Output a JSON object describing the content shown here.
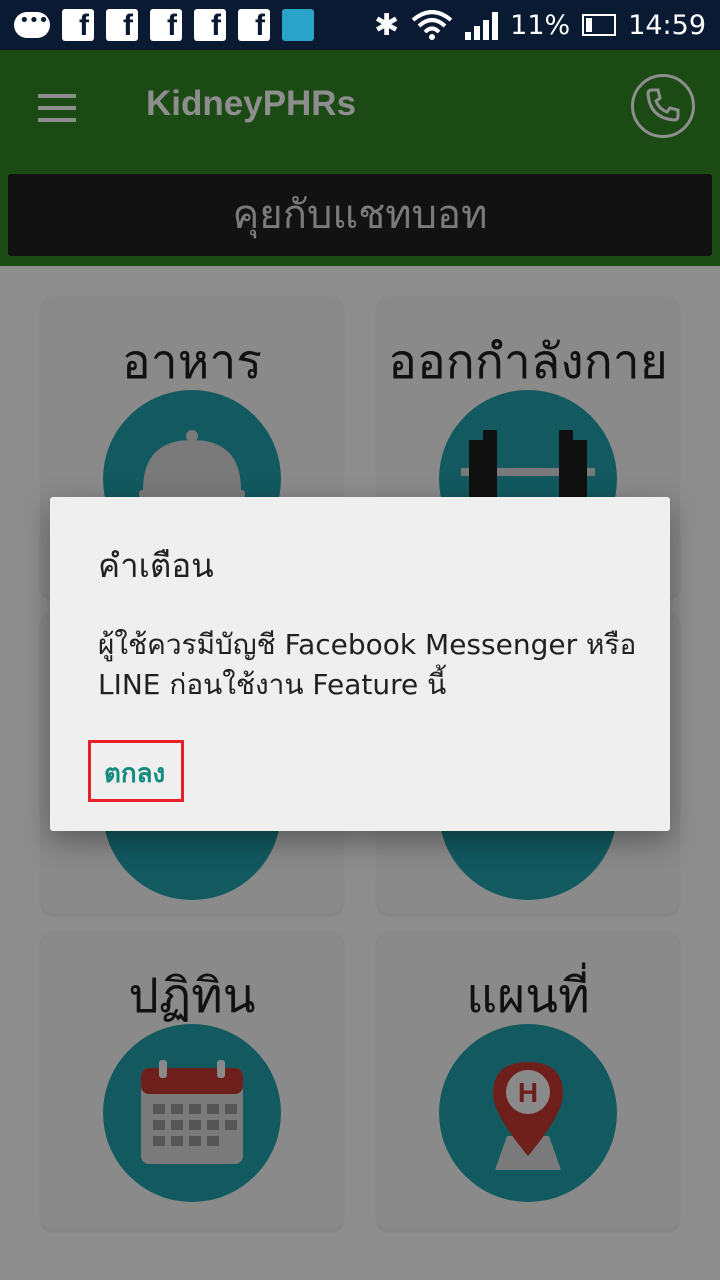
{
  "status_bar": {
    "battery_percent": "11%",
    "time": "14:59",
    "icons": [
      "message-icon",
      "facebook-icon",
      "facebook-icon",
      "facebook-icon",
      "facebook-icon",
      "facebook-icon",
      "screencast-icon",
      "bluetooth-icon",
      "wifi-icon",
      "signal-icon",
      "battery-charging-icon"
    ]
  },
  "toolbar": {
    "title": "KidneyPHRs",
    "menu_icon": "hamburger-menu-icon",
    "call_icon": "phone-icon"
  },
  "chatbot_button": {
    "label": "คุยกับแชทบอท"
  },
  "grid": {
    "items": [
      {
        "label": "อาหาร",
        "icon": "food-cloche-icon"
      },
      {
        "label": "ออกกำลังกาย",
        "icon": "dumbbell-icon"
      },
      {
        "label": "ปฏิทิน",
        "icon": "calendar-icon"
      },
      {
        "label": "แผนที่",
        "icon": "hospital-map-pin-icon"
      }
    ]
  },
  "dialog": {
    "title": "คำเตือน",
    "message": "ผู้ใช้ควรมีบัญชี Facebook Messenger หรือ LINE ก่อนใช้งาน Feature นี้",
    "ok_label": "ตกลง"
  },
  "colors": {
    "toolbar": "#2e7d1f",
    "accent": "#128c7e",
    "circle": "#1ca5ae",
    "highlight": "#e8202a"
  }
}
